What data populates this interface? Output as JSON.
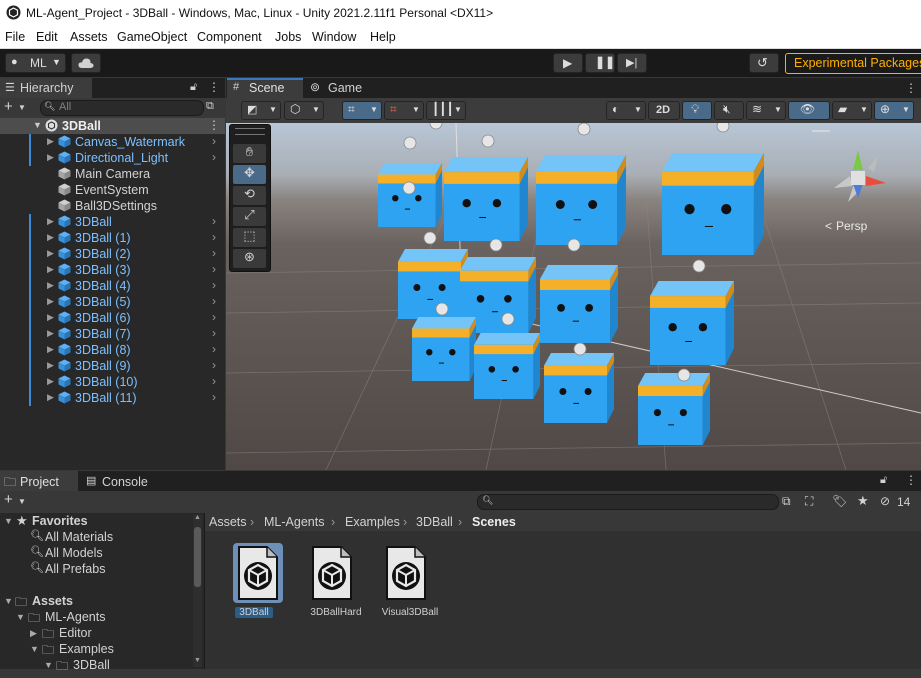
{
  "window": {
    "title": "ML-Agent_Project - 3DBall - Windows, Mac, Linux - Unity 2021.2.11f1 Personal <DX11>"
  },
  "menu": [
    "File",
    "Edit",
    "Assets",
    "GameObject",
    "Component",
    "Jobs",
    "Window",
    "Help"
  ],
  "toolbar": {
    "account": "ML",
    "experimental": "Experimental Packages"
  },
  "hierarchy": {
    "tab": "Hierarchy",
    "search_placeholder": "All",
    "root": "3DBall",
    "items": [
      {
        "label": "Canvas_Watermark",
        "blue": true,
        "expandable": true
      },
      {
        "label": "Directional_Light",
        "blue": true,
        "expandable": true
      },
      {
        "label": "Main Camera",
        "blue": false,
        "expandable": false
      },
      {
        "label": "EventSystem",
        "blue": false,
        "expandable": false
      },
      {
        "label": "Ball3DSettings",
        "blue": false,
        "expandable": false
      },
      {
        "label": "3DBall",
        "blue": true,
        "expandable": true
      },
      {
        "label": "3DBall (1)",
        "blue": true,
        "expandable": true
      },
      {
        "label": "3DBall (2)",
        "blue": true,
        "expandable": true
      },
      {
        "label": "3DBall (3)",
        "blue": true,
        "expandable": true
      },
      {
        "label": "3DBall (4)",
        "blue": true,
        "expandable": true
      },
      {
        "label": "3DBall (5)",
        "blue": true,
        "expandable": true
      },
      {
        "label": "3DBall (6)",
        "blue": true,
        "expandable": true
      },
      {
        "label": "3DBall (7)",
        "blue": true,
        "expandable": true
      },
      {
        "label": "3DBall (8)",
        "blue": true,
        "expandable": true
      },
      {
        "label": "3DBall (9)",
        "blue": true,
        "expandable": true
      },
      {
        "label": "3DBall (10)",
        "blue": true,
        "expandable": true
      },
      {
        "label": "3DBall (11)",
        "blue": true,
        "expandable": true
      }
    ]
  },
  "scene": {
    "tab_scene": "Scene",
    "tab_game": "Game",
    "btn_2d": "2D",
    "persp": "Persp"
  },
  "project": {
    "tab_project": "Project",
    "tab_console": "Console",
    "hidden_count": "14",
    "favorites_label": "Favorites",
    "favorites": [
      "All Materials",
      "All Models",
      "All Prefabs"
    ],
    "assets_label": "Assets",
    "tree": [
      "ML-Agents",
      "Editor",
      "Examples",
      "3DBall"
    ],
    "breadcrumb": [
      "Assets",
      "ML-Agents",
      "Examples",
      "3DBall",
      "Scenes"
    ],
    "files": [
      "3DBall",
      "3DBallHard",
      "Visual3DBall"
    ]
  },
  "colors": {
    "accent": "#ffb000",
    "selection": "#2c5d87",
    "agent_blue": "#2ea3f2",
    "agent_band": "#f5b02a"
  }
}
